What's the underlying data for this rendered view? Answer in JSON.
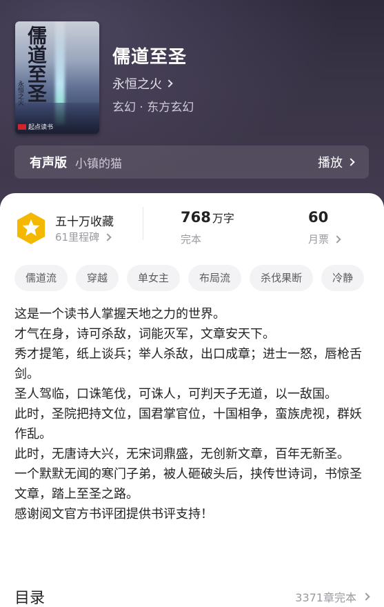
{
  "book": {
    "title": "儒道至圣",
    "author": "永恒之火",
    "genre": "玄幻 · 东方玄幻",
    "cover": {
      "title_text": "儒道至圣",
      "author_text": "永恒之火",
      "brand": "起点读书"
    }
  },
  "audio": {
    "label": "有声版",
    "narrator": "小镇的猫",
    "play_label": "播放"
  },
  "stats": {
    "favorites": "五十万收藏",
    "milestone": "61里程碑",
    "word_count": "768",
    "word_unit": "万字",
    "status": "完本",
    "monthly_tickets": "60",
    "tickets_label": "月票"
  },
  "tags": [
    "儒道流",
    "穿越",
    "单女主",
    "布局流",
    "杀伐果断",
    "冷静"
  ],
  "synopsis": [
    "这是一个读书人掌握天地之力的世界。",
    "才气在身，诗可杀敌，词能灭军，文章安天下。",
    "秀才提笔，纸上谈兵；举人杀敌，出口成章；进士一怒，唇枪舌剑。",
    "圣人驾临，口诛笔伐，可诛人，可判天子无道，以一敌国。",
    "此时，圣院把持文位，国君掌官位，十国相争，蛮族虎视，群妖作乱。",
    "此时，无唐诗大兴，无宋词鼎盛，无创新文章，百年无新圣。",
    "一个默默无闻的寒门子弟，被人砸破头后，挟传世诗词，书惊圣文章，踏上至圣之路。",
    "感谢阅文官方书评团提供书评支持！"
  ],
  "toc": {
    "title": "目录",
    "summary": "3371章完本"
  },
  "colors": {
    "hero_bg": "#3a3447",
    "badge_gold": "#f5b800",
    "text_muted": "#9a9aa0"
  }
}
